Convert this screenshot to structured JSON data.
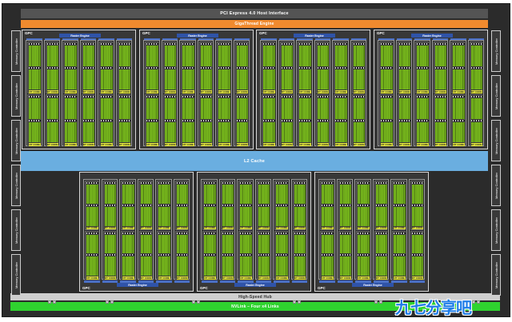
{
  "diagram": {
    "pcie_label": "PCI Express 4.0 Host Interface",
    "gigathread_label": "GigaThread Engine",
    "l2_label": "L2 Cache",
    "hub_label": "High-Speed Hub",
    "nvlink_label": "NVLink – Four x4 Links",
    "memory_controller_label": "Memory Controller",
    "gpc_label": "GPC",
    "raster_label": "Raster Engine",
    "rt_core_label": "RT CORE",
    "watermark": "九七分享吧",
    "colors": {
      "die_background": "#2b2b2b",
      "gigathread": "#f08a2e",
      "l2_cache": "#6aaee0",
      "nvlink": "#2fd32f",
      "raster_engine": "#2f53a8",
      "cuda_cores": "#7fc41e",
      "rt_core": "#e6ea3c",
      "watermark": "#1f7de8"
    }
  }
}
